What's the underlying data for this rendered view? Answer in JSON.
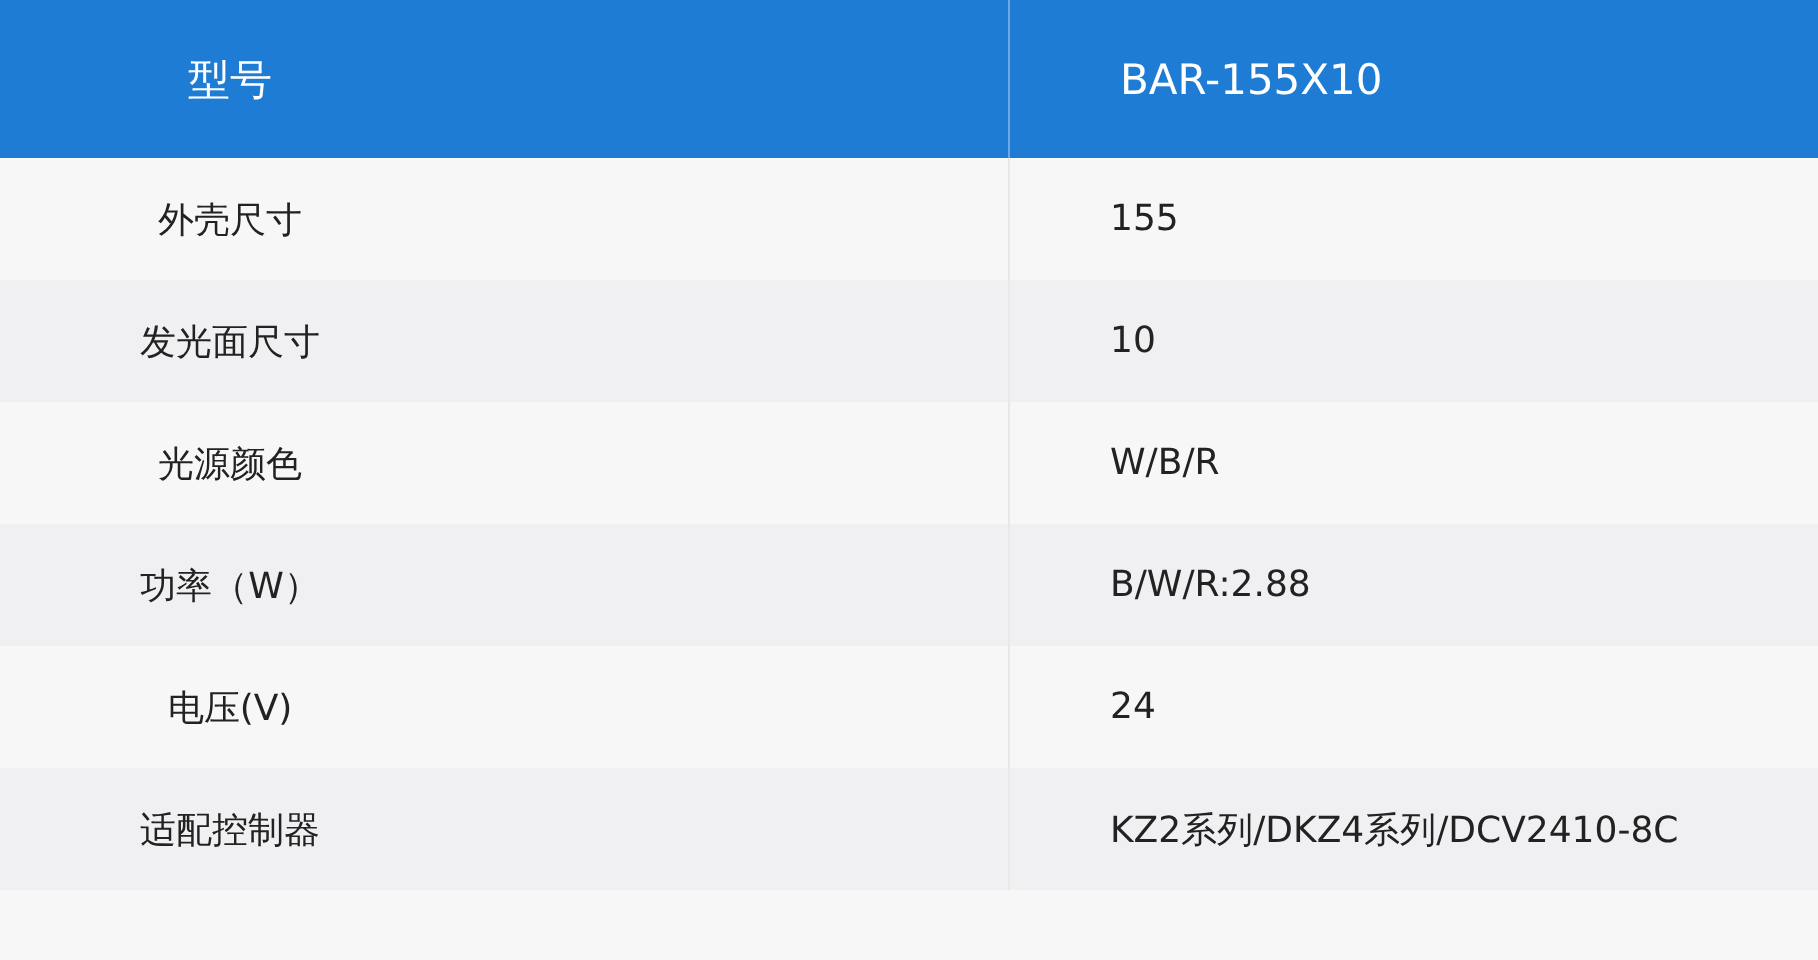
{
  "table": {
    "header": {
      "label": "型号",
      "value": "BAR-155X10"
    },
    "rows": [
      {
        "label": "外壳尺寸",
        "value": "155"
      },
      {
        "label": "发光面尺寸",
        "value": "10"
      },
      {
        "label": "光源颜色",
        "value": "W/B/R"
      },
      {
        "label": "功率（W）",
        "value": "B/W/R:2.88"
      },
      {
        "label": "电压(V)",
        "value": "24"
      },
      {
        "label": "适配控制器",
        "value": "KZ2系列/DKZ4系列/DCV2410-8C"
      }
    ]
  }
}
